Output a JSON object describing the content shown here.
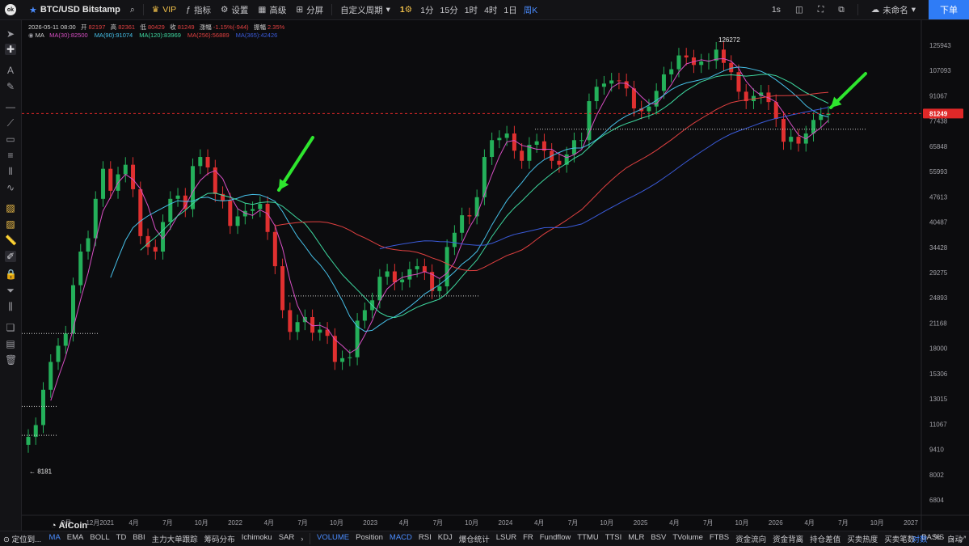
{
  "toolbar": {
    "symbol": "BTC/USD Bitstamp",
    "vip": "VIP",
    "indicators": "指标",
    "settings": "设置",
    "advanced": "高级",
    "split_screen": "分屏",
    "custom_period": "自定义周期",
    "periods": [
      "1分",
      "15分",
      "1时",
      "4时",
      "1日",
      "周K"
    ],
    "active_period": "周K",
    "refresh_rate": "1s",
    "cloud_status": "未命名",
    "order_button": "下单"
  },
  "info_line": {
    "date": "2026-05-11 08:00",
    "open_label": "开",
    "open": "82197",
    "high_label": "高",
    "high": "82361",
    "low_label": "低",
    "low": "80429",
    "close_label": "收",
    "close": "81249",
    "change_label": "涨幅",
    "change": "-1.15%(-944)",
    "amplitude_label": "振幅",
    "amplitude": "2.35%"
  },
  "ma_line": {
    "label": "MA",
    "items": [
      {
        "text": "MA(30):82500",
        "color": "#d84fc4"
      },
      {
        "text": "MA(90):91074",
        "color": "#46c0e8"
      },
      {
        "text": "MA(120):83969",
        "color": "#3ed9a0"
      },
      {
        "text": "MA(256):56889",
        "color": "#e04040"
      },
      {
        "text": "MA(365):42426",
        "color": "#3a5ad8"
      }
    ]
  },
  "colors": {
    "up": "#24b05a",
    "down": "#e03030",
    "current_price_bg": "#e02828",
    "accent": "#2f7cf6",
    "arrow": "#2ee62e"
  },
  "chart_data": {
    "type": "candlestick",
    "scale": "log",
    "y_ticks": [
      "125943",
      "107093",
      "91067",
      "77438",
      "65848",
      "55993",
      "47613",
      "40487",
      "34428",
      "29275",
      "24893",
      "21168",
      "18000",
      "15306",
      "13015",
      "11067",
      "9410",
      "8002",
      "6804"
    ],
    "x_ticks": [
      "9月",
      "12月2021",
      "4月",
      "7月",
      "10月",
      "2022",
      "4月",
      "7月",
      "10月",
      "2023",
      "4月",
      "7月",
      "10月",
      "2024",
      "4月",
      "7月",
      "10月",
      "2025",
      "4月",
      "7月",
      "10月",
      "2026",
      "4月",
      "7月",
      "10月",
      "2027"
    ],
    "current_price": "81249",
    "high_marker": "126272",
    "low_marker": "8181",
    "close_series": [
      10200,
      11000,
      13800,
      16500,
      18300,
      19800,
      27000,
      33500,
      36500,
      47000,
      57000,
      49500,
      55000,
      58500,
      50000,
      37000,
      34500,
      33500,
      40500,
      47000,
      48000,
      44000,
      58000,
      61500,
      57500,
      48500,
      46500,
      39500,
      42000,
      43500,
      44000,
      45500,
      38000,
      30500,
      23000,
      20000,
      21300,
      22000,
      19900,
      20300,
      19500,
      16500,
      16900,
      17000,
      21500,
      23000,
      24500,
      28500,
      29500,
      27500,
      28000,
      29900,
      30500,
      29400,
      26000,
      26800,
      34500,
      37800,
      42300,
      42000,
      47500,
      61500,
      68500,
      69500,
      71500,
      64000,
      60000,
      66500,
      68000,
      64000,
      60000,
      58500,
      62500,
      68500,
      68500,
      88000,
      96500,
      98500,
      100500,
      100000,
      95500,
      84000,
      82500,
      85000,
      94000,
      104500,
      108000,
      118000,
      116500,
      111000,
      113500,
      114000,
      122500,
      112500,
      106000,
      93500,
      88000,
      91000,
      93000,
      87500,
      78500,
      67800,
      70000,
      67000,
      71500,
      78000,
      80500,
      81249
    ],
    "ohlc_summary": {
      "open": 82197,
      "high": 82361,
      "low": 80429,
      "close": 81249
    },
    "moving_averages": [
      {
        "name": "MA(30)",
        "value": 82500
      },
      {
        "name": "MA(90)",
        "value": 91074
      },
      {
        "name": "MA(120)",
        "value": 83969
      },
      {
        "name": "MA(256)",
        "value": 56889
      },
      {
        "name": "MA(365)",
        "value": 42426
      }
    ]
  },
  "bottom": {
    "locate": "定位到...",
    "main_indicators": [
      "MA",
      "EMA",
      "BOLL",
      "TD",
      "BBI",
      "主力大单跟踪",
      "筹码分布",
      "Ichimoku",
      "SAR"
    ],
    "active_main": "MA",
    "sub_indicators": [
      "VOLUME",
      "Position",
      "MACD",
      "RSI",
      "KDJ",
      "爆仓统计",
      "LSUR",
      "FR",
      "Fundflow",
      "TTMU",
      "TTSI",
      "MLR",
      "BSV",
      "TVolume",
      "FTBS",
      "资金流向",
      "资金背离",
      "持仓差值",
      "买卖热度",
      "买卖笔数",
      "BASIS"
    ],
    "active_subs": [
      "VOLUME",
      "MACD"
    ],
    "right_items": [
      "对数",
      "%",
      "自动"
    ],
    "active_right": "对数",
    "brand": "AiCoin"
  }
}
